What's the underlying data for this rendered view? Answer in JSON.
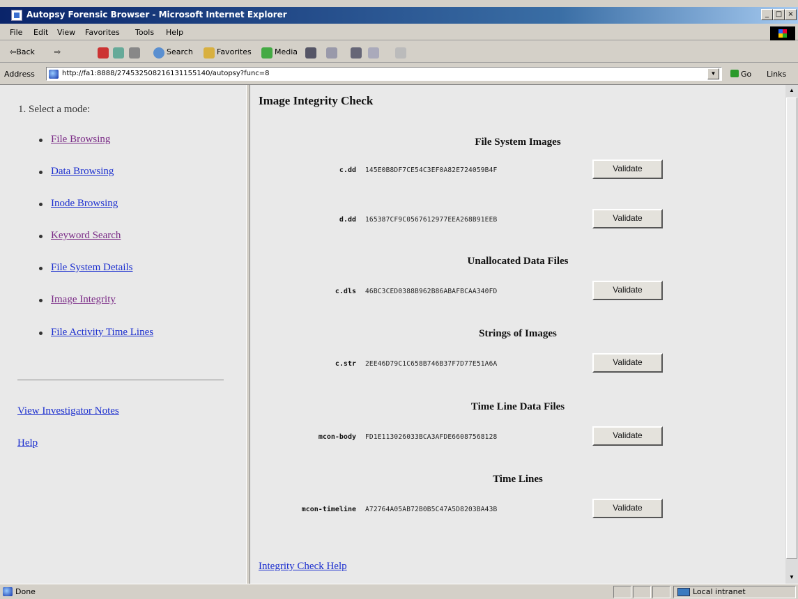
{
  "window": {
    "title": "Autopsy Forensic Browser - Microsoft Internet Explorer",
    "buttons": [
      "_",
      "□",
      "×"
    ]
  },
  "menu": [
    "File",
    "Edit",
    "View",
    "Favorites",
    "Tools",
    "Help"
  ],
  "toolbar": {
    "back": "⇦Back",
    "forward": "⇨",
    "search": "Search",
    "favorites": "Favorites",
    "media": "Media"
  },
  "address": {
    "label": "Address",
    "url": "http://fa1:8888/274532508216131155140/autopsy?func=8",
    "go": "Go",
    "links": "Links"
  },
  "sidebar": {
    "heading": "1. Select a mode:",
    "items": [
      {
        "label": "File Browsing",
        "visited": true
      },
      {
        "label": "Data Browsing",
        "visited": false
      },
      {
        "label": "Inode Browsing",
        "visited": false
      },
      {
        "label": "Keyword Search",
        "visited": true
      },
      {
        "label": "File System Details",
        "visited": false
      },
      {
        "label": "Image Integrity",
        "visited": true
      },
      {
        "label": "File Activity Time Lines",
        "visited": false
      }
    ],
    "notes": "View Investigator Notes",
    "help": "Help"
  },
  "main": {
    "title": "Image Integrity Check",
    "validate_label": "Validate",
    "sections": [
      {
        "heading": "File System Images",
        "files": [
          {
            "name": "c.dd",
            "hash": "145E0B8DF7CE54C3EF0A82E724059B4F"
          },
          {
            "name": "d.dd",
            "hash": "165387CF9C0567612977EEA268B91EEB"
          }
        ]
      },
      {
        "heading": "Unallocated Data Files",
        "files": [
          {
            "name": "c.dls",
            "hash": "46BC3CED0388B962B86ABAFBCAA340FD"
          }
        ]
      },
      {
        "heading": "Strings of Images",
        "files": [
          {
            "name": "c.str",
            "hash": "2EE46D79C1C658B746B37F7D77E51A6A"
          }
        ]
      },
      {
        "heading": "Time Line Data Files",
        "files": [
          {
            "name": "mcon-body",
            "hash": "FD1E113026033BCA3AFDE66087568128"
          }
        ]
      },
      {
        "heading": "Time Lines",
        "files": [
          {
            "name": "mcon-timeline",
            "hash": "A72764A05AB72B0B5C47A5D8203BA43B"
          }
        ]
      }
    ],
    "help_link": "Integrity Check Help"
  },
  "status": {
    "text": "Done",
    "zone": "Local intranet"
  },
  "colors": {
    "visited_link": "#7a2a86",
    "unvisited_link": "#1c2fcf",
    "titlebar": "#0a246a"
  }
}
